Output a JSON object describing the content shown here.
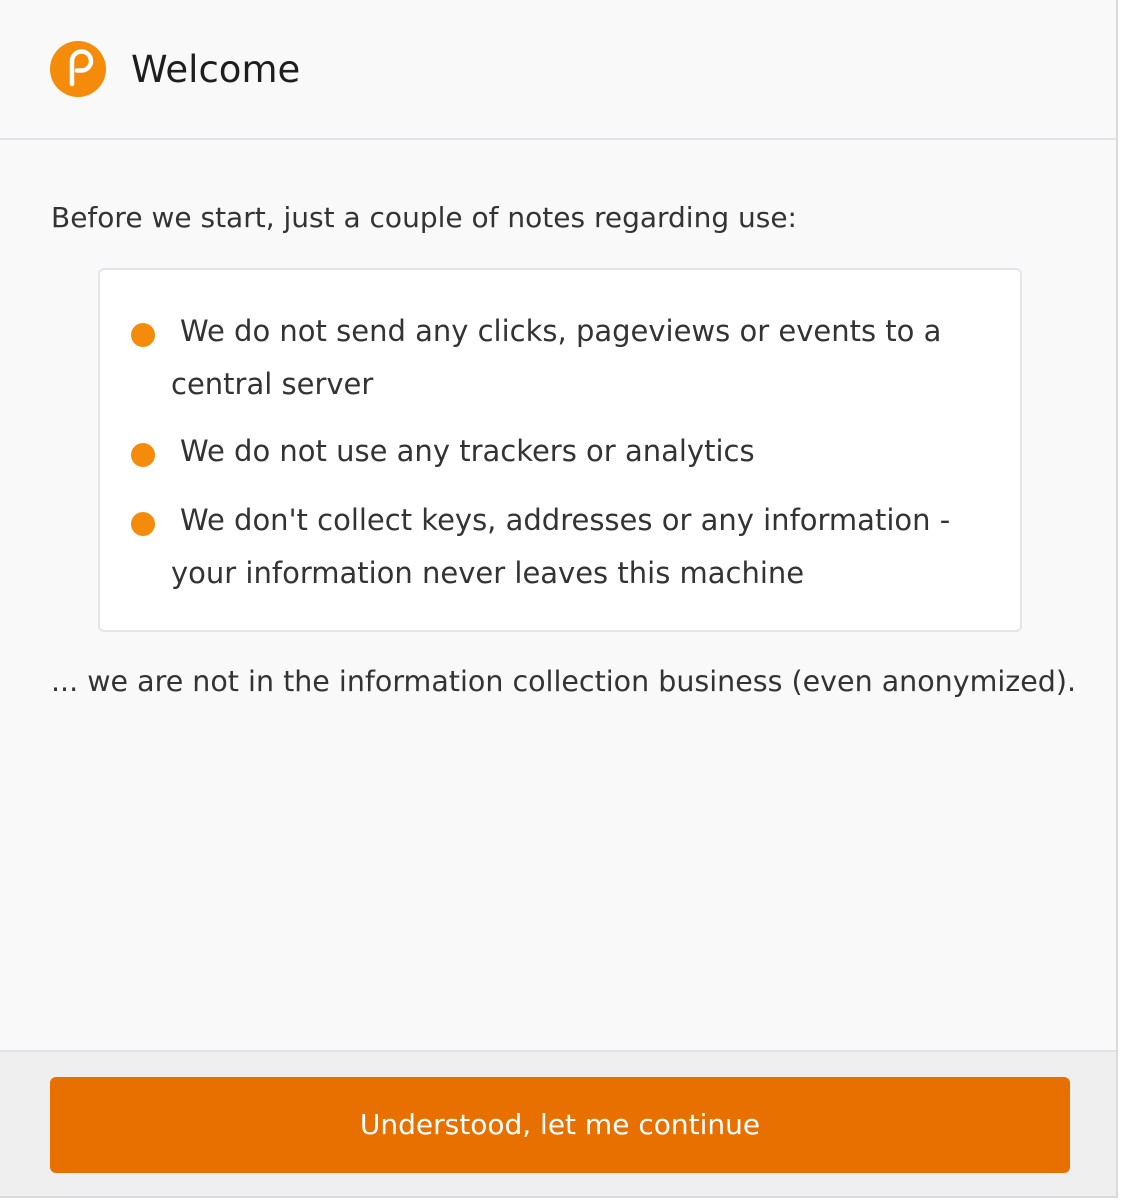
{
  "header": {
    "logo_icon": "polkadot-p-logo-icon",
    "title": "Welcome"
  },
  "content": {
    "intro": "Before we start, just a couple of notes regarding use:",
    "notes": [
      "We do not send any clicks, pageviews or events to a central server",
      "We do not use any trackers or analytics",
      "We don't collect keys, addresses or any information - your information never leaves this machine"
    ],
    "outro": "... we are not in the information collection business (even anonymized)."
  },
  "footer": {
    "continue_label": "Understood, let me continue"
  },
  "colors": {
    "accent": "#f48b0a",
    "button": "#e87000",
    "background": "#f9f9f9"
  }
}
